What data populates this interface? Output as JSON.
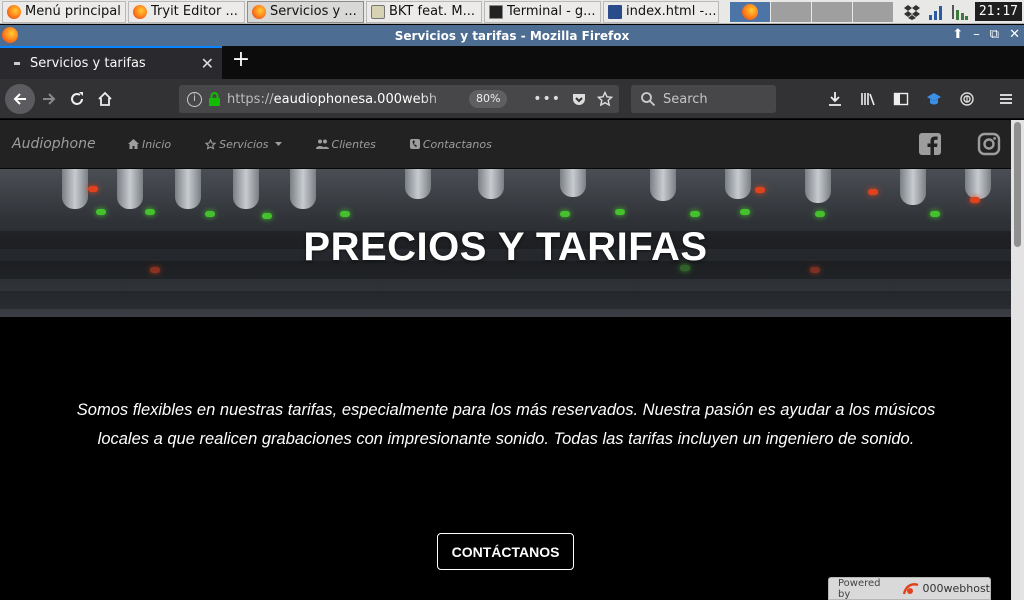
{
  "taskbar": {
    "items": [
      {
        "label": "Menú principal",
        "icon": "firefox-icon"
      },
      {
        "label": "Tryit Editor ...",
        "icon": "firefox-icon"
      },
      {
        "label": "Servicios y ...",
        "icon": "firefox-icon"
      },
      {
        "label": "BKT feat. M...",
        "icon": "media-icon"
      },
      {
        "label": "Terminal - g...",
        "icon": "terminal-icon"
      },
      {
        "label": "index.html -...",
        "icon": "editor-icon"
      }
    ],
    "clock": "21:17"
  },
  "window": {
    "title": "Servicios y tarifas - Mozilla Firefox"
  },
  "browser": {
    "tab_title": "Servicios y tarifas",
    "url_prefix": "https://",
    "url_host": "eaudiophonesa.000webh",
    "zoom": "80%",
    "search_placeholder": "Search"
  },
  "site": {
    "brand": "Audiophone",
    "nav": [
      {
        "label": "Inicio",
        "icon": "home-icon"
      },
      {
        "label": "Servicios",
        "icon": "star-icon",
        "caret": true
      },
      {
        "label": "Clientes",
        "icon": "users-icon"
      },
      {
        "label": "Contactanos",
        "icon": "phone-icon"
      }
    ],
    "hero_title": "PRECIOS Y TARIFAS",
    "intro": "Somos flexibles en nuestras tarifas, especialmente para los más reservados. Nuestra pasión es ayudar a los músicos locales a que realicen grabaciones con impresionante sonido. Todas las tarifas incluyen un ingeniero de sonido.",
    "cta_label": "CONTÁCTANOS",
    "powered_by": "Powered by",
    "host_name": "000webhost"
  },
  "colors": {
    "navbar_bg": "#222222",
    "nav_text": "#9d9d9d",
    "page_bg": "#000000",
    "accent_led_green": "#45c12e",
    "accent_led_red": "#e0421d",
    "window_title_bg": "#4d6d92"
  }
}
